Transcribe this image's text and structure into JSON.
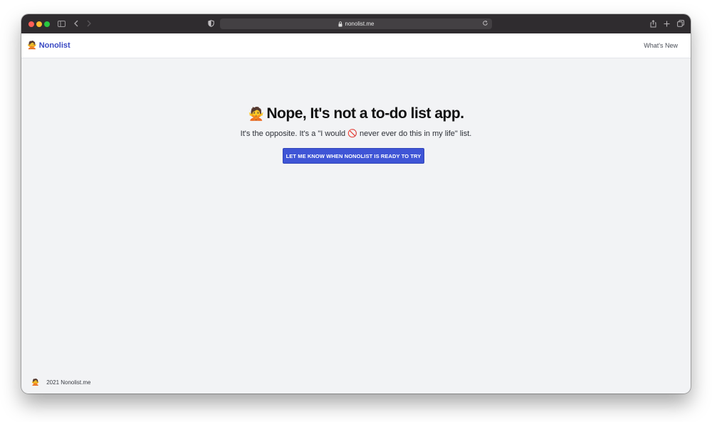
{
  "browser": {
    "url": "nonolist.me"
  },
  "navbar": {
    "brand_emoji": "🙅",
    "brand_name": "Nonolist",
    "whats_new": "What's New"
  },
  "hero": {
    "emoji": "🙅",
    "headline": "Nope, It's not a to-do list app.",
    "sub_before": "It's the opposite. It's a \"I would",
    "sub_emoji": "🚫",
    "sub_after": "never ever do this in my life\" list.",
    "cta_label": "LET ME KNOW WHEN NONOLIST IS READY TO TRY"
  },
  "footer": {
    "emoji": "🙅",
    "text": "2021 Nonolist.me"
  },
  "colors": {
    "brand": "#3848c3",
    "cta_bg": "#3f55d6",
    "page_bg": "#f2f3f5",
    "titlebar": "#2f2c2f"
  }
}
